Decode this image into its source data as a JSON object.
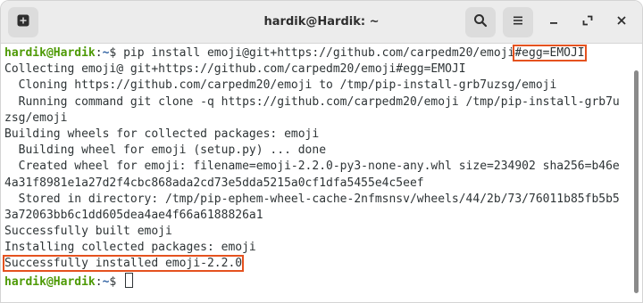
{
  "window": {
    "title": "hardik@Hardik: ~",
    "icons": {
      "new_tab": "new-tab-icon",
      "search": "search-icon",
      "menu": "hamburger-menu-icon",
      "minimize": "minimize-icon",
      "maximize": "maximize-icon",
      "close": "close-icon"
    }
  },
  "terminal": {
    "prompt_user": "hardik@Hardik",
    "prompt_sep": ":~$ ",
    "command_main": "pip install emoji@git+https://github.com/carpedm20/emoji",
    "command_highlight": "#egg=EMOJI",
    "output": [
      "Collecting emoji@ git+https://github.com/carpedm20/emoji#egg=EMOJI",
      "  Cloning https://github.com/carpedm20/emoji to /tmp/pip-install-grb7uzsg/emoji",
      "  Running command git clone -q https://github.com/carpedm20/emoji /tmp/pip-install-grb7u",
      "zsg/emoji",
      "Building wheels for collected packages: emoji",
      "  Building wheel for emoji (setup.py) ... done",
      "  Created wheel for emoji: filename=emoji-2.2.0-py3-none-any.whl size=234902 sha256=b46e",
      "4a31f8981e1a27d2f4cbc868ada2cd73e5dda5215a0cf1dfa5455e4c5eef",
      "  Stored in directory: /tmp/pip-ephem-wheel-cache-2nfmsnsv/wheels/44/2b/73/76011b85fb5b5",
      "3a72063bb6c1dd605dea4ae4f66a6188826a1",
      "Successfully built emoji",
      "Installing collected packages: emoji"
    ],
    "success_line": "Successfully installed emoji-2.2.0",
    "highlight_color": "#e5521f",
    "user_color": "#4e9a06",
    "path_color": "#3465a4"
  }
}
